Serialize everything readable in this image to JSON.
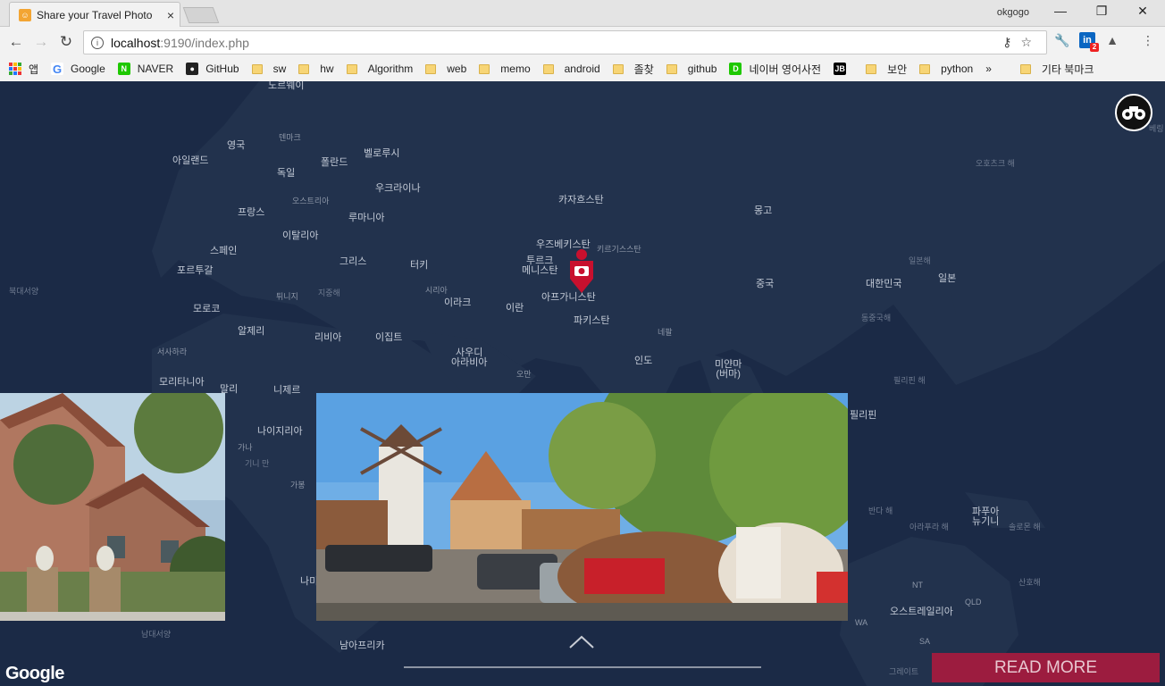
{
  "browser": {
    "tab_title": "Share your Travel Photo",
    "tab_close": "×",
    "profile": "okgogo",
    "window_controls": [
      "—",
      "❐",
      "✕"
    ],
    "url_host": "localhost",
    "url_path": ":9190/index.php",
    "bookmarks": [
      {
        "label": "앱",
        "icon": "apps-grid-icon"
      },
      {
        "label": "Google",
        "icon": "google-icon"
      },
      {
        "label": "NAVER",
        "icon": "naver-icon"
      },
      {
        "label": "GitHub",
        "icon": "github-icon"
      },
      {
        "label": "sw",
        "icon": "folder-icon"
      },
      {
        "label": "hw",
        "icon": "folder-icon"
      },
      {
        "label": "Algorithm",
        "icon": "folder-icon"
      },
      {
        "label": "web",
        "icon": "folder-icon"
      },
      {
        "label": "memo",
        "icon": "folder-icon"
      },
      {
        "label": "android",
        "icon": "folder-icon"
      },
      {
        "label": "졸찾",
        "icon": "folder-icon"
      },
      {
        "label": "github",
        "icon": "folder-icon"
      },
      {
        "label": "네이버 영어사전",
        "icon": "dict-icon"
      },
      {
        "label": "",
        "icon": "jb-icon"
      },
      {
        "label": "보안",
        "icon": "folder-icon"
      },
      {
        "label": "python",
        "icon": "folder-icon"
      }
    ],
    "bookmarks_overflow": "»",
    "other_bookmarks": "기타 북마크",
    "linkedin_badge": "2"
  },
  "map": {
    "labels": [
      {
        "text": "노르웨이",
        "cls": "big"
      },
      {
        "text": "아일랜드",
        "cls": "big"
      },
      {
        "text": "영국",
        "cls": "big"
      },
      {
        "text": "덴마크",
        "cls": "sm"
      },
      {
        "text": "벨로루시",
        "cls": "big"
      },
      {
        "text": "폴란드",
        "cls": "big"
      },
      {
        "text": "독일",
        "cls": "big"
      },
      {
        "text": "우크라이나",
        "cls": "big"
      },
      {
        "text": "오스트리아",
        "cls": "sm"
      },
      {
        "text": "프랑스",
        "cls": "big"
      },
      {
        "text": "루마니아",
        "cls": "big"
      },
      {
        "text": "카자흐스탄",
        "cls": "big"
      },
      {
        "text": "몽고",
        "cls": "big"
      },
      {
        "text": "오호츠크 해",
        "cls": "sea"
      },
      {
        "text": "스페인",
        "cls": "big"
      },
      {
        "text": "이탈리아",
        "cls": "big"
      },
      {
        "text": "우즈베키스탄",
        "cls": "big"
      },
      {
        "text": "키르기스스탄",
        "cls": "sm"
      },
      {
        "text": "포르투갈",
        "cls": "big"
      },
      {
        "text": "그리스",
        "cls": "big"
      },
      {
        "text": "터키",
        "cls": "big"
      },
      {
        "text": "투르크\n메니스탄",
        "cls": "big"
      },
      {
        "text": "일본해",
        "cls": "sea"
      },
      {
        "text": "북대서양",
        "cls": "sea"
      },
      {
        "text": "튀니지",
        "cls": "sm"
      },
      {
        "text": "지중해",
        "cls": "sea"
      },
      {
        "text": "시리아",
        "cls": "sm"
      },
      {
        "text": "이라크",
        "cls": "big"
      },
      {
        "text": "이란",
        "cls": "big"
      },
      {
        "text": "아프가니스탄",
        "cls": "big"
      },
      {
        "text": "중국",
        "cls": "big"
      },
      {
        "text": "대한민국",
        "cls": "big"
      },
      {
        "text": "일본",
        "cls": "big"
      },
      {
        "text": "모로코",
        "cls": "big"
      },
      {
        "text": "동중국해",
        "cls": "sea"
      },
      {
        "text": "알제리",
        "cls": "big"
      },
      {
        "text": "리비아",
        "cls": "big"
      },
      {
        "text": "이집트",
        "cls": "big"
      },
      {
        "text": "파키스탄",
        "cls": "big"
      },
      {
        "text": "네팔",
        "cls": "sm"
      },
      {
        "text": "서사하라",
        "cls": "sm"
      },
      {
        "text": "사우디\n아라비아",
        "cls": "big"
      },
      {
        "text": "인도",
        "cls": "big"
      },
      {
        "text": "미얀마\n(버마)",
        "cls": "big"
      },
      {
        "text": "모리타니아",
        "cls": "big"
      },
      {
        "text": "말리",
        "cls": "big"
      },
      {
        "text": "니제르",
        "cls": "big"
      },
      {
        "text": "오만",
        "cls": "sm"
      },
      {
        "text": "필리핀 해",
        "cls": "sea"
      },
      {
        "text": "필리핀",
        "cls": "big"
      },
      {
        "text": "나이지리아",
        "cls": "big"
      },
      {
        "text": "가나",
        "cls": "sm"
      },
      {
        "text": "기니 만",
        "cls": "sea"
      },
      {
        "text": "가봉",
        "cls": "sm"
      },
      {
        "text": "반다 해",
        "cls": "sea"
      },
      {
        "text": "파푸아\n뉴기니",
        "cls": "big"
      },
      {
        "text": "아라푸라 해",
        "cls": "sea"
      },
      {
        "text": "솔로몬 해",
        "cls": "sea"
      },
      {
        "text": "나미",
        "cls": "big"
      },
      {
        "text": "NT",
        "cls": "sm"
      },
      {
        "text": "산호해",
        "cls": "sea"
      },
      {
        "text": "QLD",
        "cls": "sm"
      },
      {
        "text": "오스트레일리아",
        "cls": "big"
      },
      {
        "text": "WA",
        "cls": "sm"
      },
      {
        "text": "SA",
        "cls": "sm"
      },
      {
        "text": "남대서양",
        "cls": "sea"
      },
      {
        "text": "남아프리카",
        "cls": "big"
      },
      {
        "text": "그레이트",
        "cls": "sea"
      },
      {
        "text": "베링",
        "cls": "sea"
      }
    ]
  },
  "controls": {
    "read_more": "READ MORE",
    "google": "Google"
  },
  "colors": {
    "map_bg": "#1b2a46",
    "pin": "#c8102e",
    "read_more_bg": "#9c1c3f"
  }
}
